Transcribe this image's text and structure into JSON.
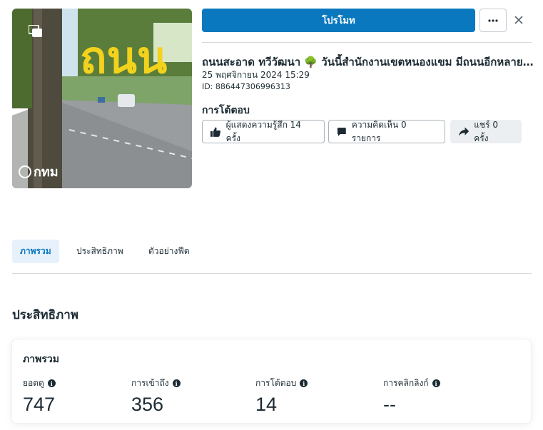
{
  "header": {
    "promote_label": "โปรโมท",
    "more_icon": "ellipsis-icon",
    "close_icon": "close-icon"
  },
  "thumbnail": {
    "sign_text": "ถนน",
    "watermark": "กทม",
    "multi_icon": "multiple-photos-icon"
  },
  "post": {
    "title": "ถนนสะอาด ทวีวัฒนา 🌳 วันนี้สำนักงานเขตหนองแขม มีถนนอีกหลายสายที่ได้รับการทำความสะอาด",
    "date": "25 พฤศจิกายน 2024 15:29",
    "id": "ID: 886447306996313"
  },
  "interactions": {
    "title": "การโต้ตอบ",
    "likes": "ผู้แสดงความรู้สึก 14 ครั้ง",
    "comments": "ความคิดเห็น 0 รายการ",
    "shares": "แชร์ 0 ครั้ง"
  },
  "tabs": [
    {
      "label": "ภาพรวม"
    },
    {
      "label": "ประสิทธิภาพ"
    },
    {
      "label": "ตัวอย่างฟีด"
    }
  ],
  "performance": {
    "section_title": "ประสิทธิภาพ",
    "card_title": "ภาพรวม",
    "metrics": [
      {
        "label": "ยอดดู",
        "value": "747"
      },
      {
        "label": "การเข้าถึง",
        "value": "356"
      },
      {
        "label": "การโต้ตอบ",
        "value": "14"
      },
      {
        "label": "การคลิกลิงก์",
        "value": "--"
      }
    ]
  },
  "colors": {
    "primary": "#0a78be",
    "text": "#1c2b33",
    "tab_active_bg": "#e6f1fb"
  }
}
